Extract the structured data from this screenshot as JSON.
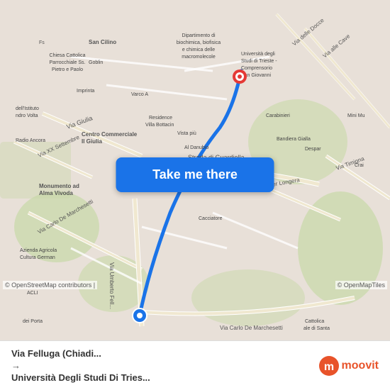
{
  "map": {
    "attribution": "© OpenStreetMap contributors |",
    "omt_attribution": "© OpenMapTiles"
  },
  "button": {
    "label": "Take me there"
  },
  "bottom_bar": {
    "from": "Via Felluga (Chiadi...",
    "to": "Università Degli Studi Di Tries...",
    "arrow": "→"
  },
  "logo": {
    "text": "moovit"
  },
  "markers": {
    "origin_color": "#1a73e8",
    "destination_color": "#e53935"
  }
}
